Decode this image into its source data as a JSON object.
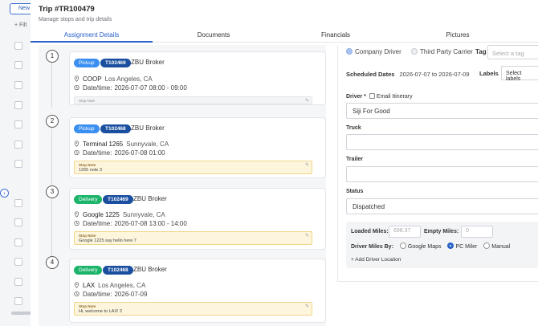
{
  "background": {
    "new_button": "New",
    "filter_label": "+ Filt"
  },
  "modal": {
    "title": "Trip #TR100479",
    "subtitle": "Manage stops and trip details",
    "tabs": [
      {
        "label": "Assignment Details",
        "active": true
      },
      {
        "label": "Documents",
        "active": false
      },
      {
        "label": "Financials",
        "active": false
      },
      {
        "label": "Pictures",
        "active": false
      }
    ]
  },
  "stops": [
    {
      "number": "1",
      "type": "Pickup",
      "trip_code": "T102469",
      "broker": "ZBU Broker",
      "location": "COOP",
      "city": "Los Angeles, CA",
      "datetime_label": "Date/time:",
      "datetime": "2026-07-07 08:00 - 09:00",
      "note_label": "Stop Note",
      "note_text": ""
    },
    {
      "number": "2",
      "type": "Pickup",
      "trip_code": "T102468",
      "broker": "ZBU Broker",
      "location": "Terminal 1265",
      "city": "Sunnyvale, CA",
      "datetime_label": "Date/time:",
      "datetime": "2026-07-08 01:00",
      "note_label": "Stop Note",
      "note_text": "1265 note 3"
    },
    {
      "number": "3",
      "type": "Delivery",
      "trip_code": "T102469",
      "broker": "ZBU Broker",
      "location": "Google 1225",
      "city": "Sunnyvale, CA",
      "datetime_label": "Date/time:",
      "datetime": "2026-07-08 13:00 - 14:00",
      "note_label": "Stop Note",
      "note_text": "Google 1225 say hello here 7"
    },
    {
      "number": "4",
      "type": "Delivery",
      "trip_code": "T102468",
      "broker": "ZBU Broker",
      "location": "LAX",
      "city": "Los Angeles, CA",
      "datetime_label": "Date/time:",
      "datetime": "2026-07-09",
      "note_label": "Stop Note",
      "note_text": "Hi, welcome to LAX! 2"
    }
  ],
  "right": {
    "driver_type": {
      "option1": "Company Driver",
      "option2": "Third Party Carrier",
      "selected": "Company Driver"
    },
    "tag": {
      "label": "Tag",
      "placeholder": "Select a tag"
    },
    "scheduled": {
      "label": "Scheduled Dates",
      "value": "2026-07-07 to 2026-07-09"
    },
    "labels": {
      "label": "Labels",
      "placeholder": "Select labels"
    },
    "driver": {
      "label": "Driver *",
      "email_itinerary": "Email Itinerary",
      "value": "Siji For Good"
    },
    "truck": {
      "label": "Truck",
      "value": ""
    },
    "trailer": {
      "label": "Trailer",
      "value": ""
    },
    "status": {
      "label": "Status",
      "value": "Dispatched"
    },
    "loaded_miles": {
      "label": "Loaded Miles:",
      "value": "698.37"
    },
    "empty_miles": {
      "label": "Empty Miles:",
      "value": "0"
    },
    "driver_miles_by": {
      "label": "Driver Miles By:",
      "options": [
        "Google Maps",
        "PC Miler",
        "Manual"
      ],
      "selected": "PC Miler"
    },
    "add_driver_location": "+ Add Driver Location"
  },
  "colors": {
    "accent": "#2a62c9",
    "pickup": "#3b8ff0",
    "delivery": "#1bb46a",
    "trip_code": "#1a4fa0",
    "note_bg": "#fdf5dc"
  }
}
